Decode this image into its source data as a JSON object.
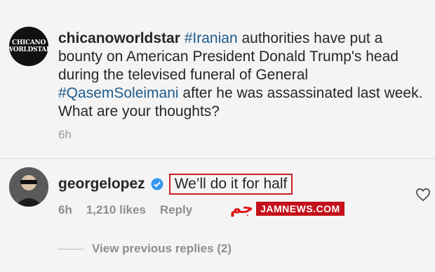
{
  "post": {
    "username": "chicanoworldstar",
    "avatar_text_1": "CHICANO",
    "avatar_text_2": "WORLDSTAR",
    "caption_part1": " ",
    "hashtag1": "#Iranian",
    "caption_part2": " authorities have put a bounty on American President Donald Trump's head during the televised funeral of General ",
    "hashtag2": "#QasemSoleimani",
    "caption_part3": " after he was assassinated last week. What are your thoughts?",
    "time": "6h"
  },
  "comment": {
    "username": "georgelopez",
    "verified_icon": "verified-badge-icon",
    "text": "We’ll do it for half",
    "time": "6h",
    "likes": "1,210 likes",
    "reply_label": "Reply",
    "heart_icon": "heart-outline-icon"
  },
  "watermark": {
    "logo": "ﺟﻢ",
    "text": "JAMNEWS.COM"
  },
  "view_replies": "View previous replies (2)",
  "colors": {
    "hashtag": "#1d5b8c",
    "verified": "#3897f0",
    "highlight_box": "#cc2222",
    "watermark": "#c4101a"
  }
}
